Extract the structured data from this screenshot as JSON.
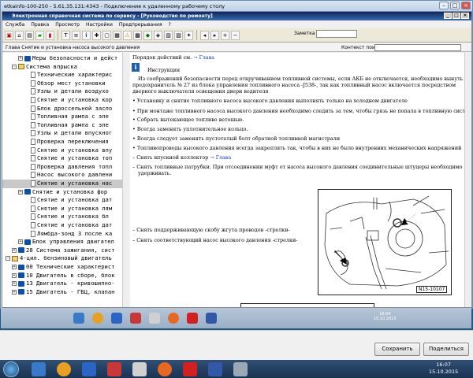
{
  "rdp": {
    "title": "etkainfo-100-250 - 5.61.35.131:4343 - Подключение к удаленному рабочему столу"
  },
  "app": {
    "title": "Электронная справочная система по сервису - [Руководство по ремонту]",
    "menu": [
      "Служба",
      "Правка",
      "Просмотр",
      "Настройки",
      "Предпрерывания",
      "?"
    ],
    "note_label": "Заметка к заказу:",
    "path": "Глава Снятие и установка насоса высокого давления",
    "context_label": "Контекст поиска:"
  },
  "tree": [
    {
      "indent": 2,
      "icon": "book",
      "exp": "+",
      "text": "Меры безопасности и дейст"
    },
    {
      "indent": 1,
      "icon": "open",
      "exp": "-",
      "text": "Система впрыска"
    },
    {
      "indent": 3,
      "icon": "page",
      "exp": "",
      "text": "Технические характерис"
    },
    {
      "indent": 3,
      "icon": "page",
      "exp": "",
      "text": "Обзор мест установки"
    },
    {
      "indent": 3,
      "icon": "page",
      "exp": "",
      "text": "Узлы и детали воздухо"
    },
    {
      "indent": 3,
      "icon": "page",
      "exp": "",
      "text": "Снятие и установка кор"
    },
    {
      "indent": 3,
      "icon": "page",
      "exp": "",
      "text": "Блок дроссельной засло"
    },
    {
      "indent": 3,
      "icon": "page",
      "exp": "",
      "text": "Топливная рампа с эле"
    },
    {
      "indent": 3,
      "icon": "page",
      "exp": "",
      "text": "Топливная рампа с эле"
    },
    {
      "indent": 3,
      "icon": "page",
      "exp": "",
      "text": "Узлы и детали впускног"
    },
    {
      "indent": 3,
      "icon": "page",
      "exp": "",
      "text": "Проверка переключения"
    },
    {
      "indent": 3,
      "icon": "page",
      "exp": "",
      "text": "Снятие и установка впу"
    },
    {
      "indent": 3,
      "icon": "page",
      "exp": "",
      "text": "Снятие и установка топ"
    },
    {
      "indent": 3,
      "icon": "page",
      "exp": "",
      "text": "Проверка давления топл"
    },
    {
      "indent": 3,
      "icon": "page",
      "exp": "",
      "text": "Насос высокого давлени"
    },
    {
      "indent": 3,
      "icon": "page",
      "exp": "",
      "text": "Снятие и установка нас",
      "selected": true
    },
    {
      "indent": 2,
      "icon": "book",
      "exp": "+",
      "text": "Снятие и установка фор"
    },
    {
      "indent": 3,
      "icon": "page",
      "exp": "",
      "text": "Снятие и установка дат"
    },
    {
      "indent": 3,
      "icon": "page",
      "exp": "",
      "text": "Снятие и установка лям"
    },
    {
      "indent": 3,
      "icon": "page",
      "exp": "",
      "text": "Снятие и установка бл"
    },
    {
      "indent": 3,
      "icon": "page",
      "exp": "",
      "text": "Снятие и установка дат"
    },
    {
      "indent": 3,
      "icon": "page",
      "exp": "",
      "text": "Лямбда-зонд 3 после ка"
    },
    {
      "indent": 2,
      "icon": "book",
      "exp": "+",
      "text": "Блок управления двигател"
    },
    {
      "indent": 1,
      "icon": "book",
      "exp": "+",
      "text": "28 Система зажигания, сист"
    },
    {
      "indent": 0,
      "icon": "open",
      "exp": "-",
      "text": "4-цил. бензиновый двигатель"
    },
    {
      "indent": 1,
      "icon": "book",
      "exp": "+",
      "text": "00 Технические характерист"
    },
    {
      "indent": 1,
      "icon": "book",
      "exp": "+",
      "text": "10 Двигатель в сборе, блок"
    },
    {
      "indent": 1,
      "icon": "book",
      "exp": "+",
      "text": "13 Двигатель - кривошипно-"
    },
    {
      "indent": 1,
      "icon": "book",
      "exp": "+",
      "text": "15 Двигатель - ГБЦ, клапан"
    }
  ],
  "content": {
    "l0_pre": "Порядок действий см.",
    "l0_link": "→ Глава",
    "instr_title": "Инструкция",
    "p1": "Из соображений безопасности перед откручиванием топливной системы, если АКБ не отключается, необходимо вынуть",
    "p2": "предохранитель № 27 из блока управления топливного насоса -J538-, так как топливный насос включается посредством",
    "p3": "дверного выключателя освещения двери водителя",
    "b1": "Установку и снятие топливного насоса высокого давления выполнять только на холодном двигателе",
    "b2": "При монтаже топливного насоса высокого давления необходимо следить за тем, чтобы грязь не попала в топливную систему.",
    "b3": "Собрать вытекающее топливо ветошью.",
    "b4": "Всегда заменять уплотнительное кольцо.",
    "b5": "Всегда следует заменять пустотелый болт обратной топливной магистрали",
    "b6": "Топливопроводы высокого давления всегда закреплять так, чтобы в них не было внутренних механических напряжений",
    "s1_pre": "Снять впускной коллектор",
    "s1_link": "→ Глава",
    "s2a": "Снять топливные патрубки. При отсоединении муфт от насоса высокого давления соединительные штуцеры необходимо",
    "s2b": "удерживать.",
    "s3": "Снять поддерживающую скобу жгута проводов -стрелки-",
    "s4": "Снять соответствующий насос высокого давления -стрелки-",
    "figure_label": "N15-10107"
  },
  "rdp_clock": {
    "time": "16:04",
    "date": "15.10.2015"
  },
  "buttons": {
    "save": "Сохранить",
    "share": "Поделиться"
  },
  "clock": {
    "time": "16:07",
    "date": "15.10.2015"
  }
}
